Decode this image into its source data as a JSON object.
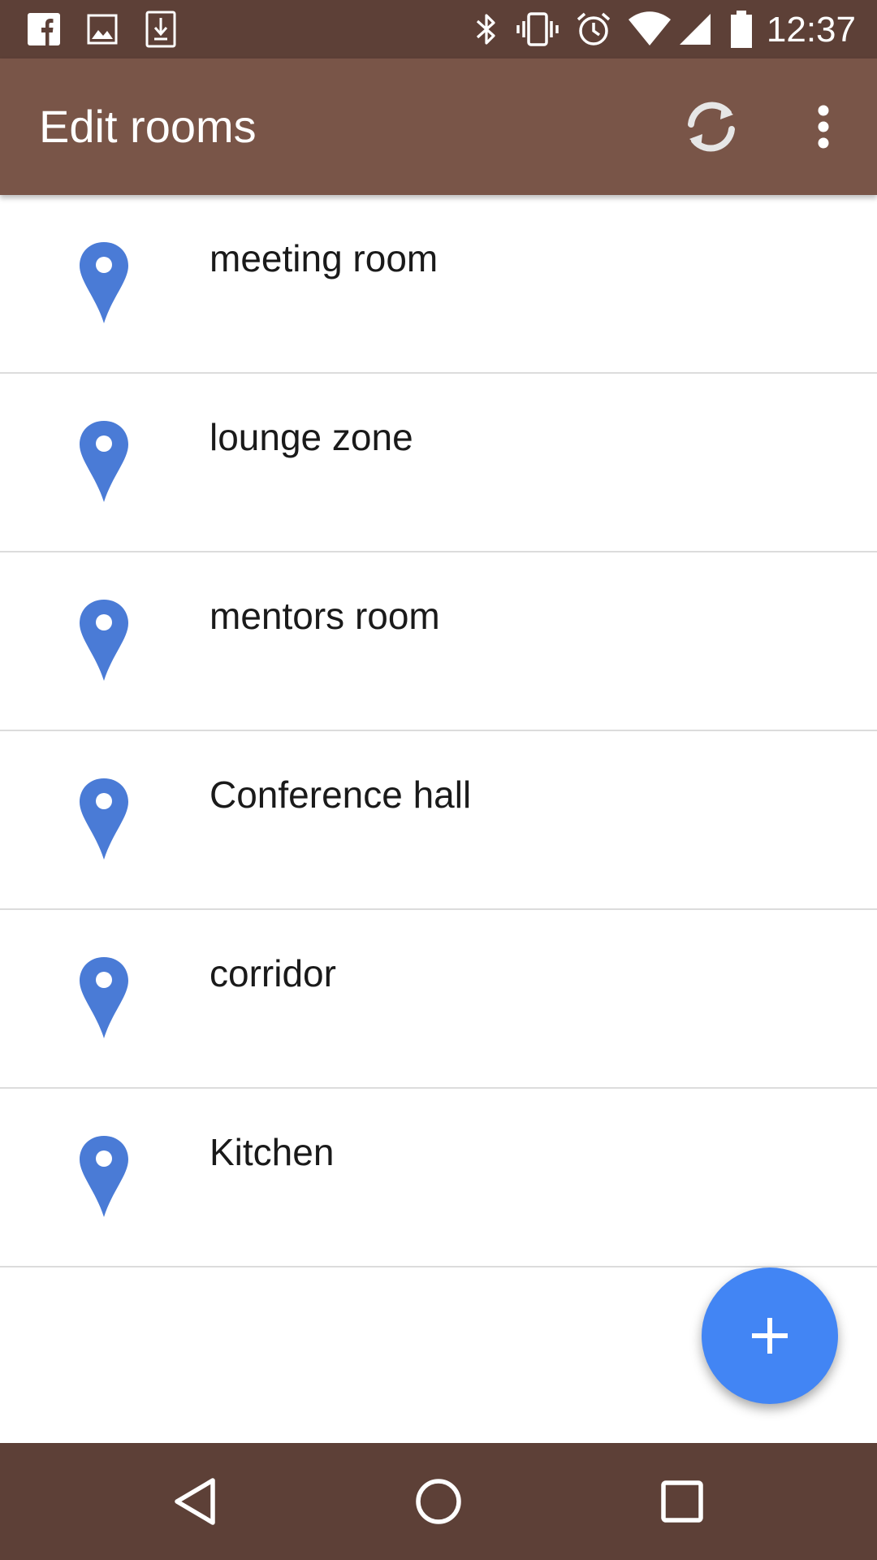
{
  "status_bar": {
    "time": "12:37",
    "left_icons": [
      "facebook-icon",
      "image-icon",
      "download-icon"
    ],
    "right_icons": [
      "bluetooth-icon",
      "vibrate-icon",
      "alarm-icon",
      "wifi-icon",
      "signal-icon",
      "battery-icon"
    ]
  },
  "app_bar": {
    "title": "Edit rooms",
    "actions": [
      "sync-icon",
      "overflow-menu-icon"
    ]
  },
  "rooms": [
    {
      "label": "meeting room",
      "icon": "location-pin-icon"
    },
    {
      "label": "lounge zone",
      "icon": "location-pin-icon"
    },
    {
      "label": "mentors room",
      "icon": "location-pin-icon"
    },
    {
      "label": "Conference hall",
      "icon": "location-pin-icon"
    },
    {
      "label": "corridor",
      "icon": "location-pin-icon"
    },
    {
      "label": "Kitchen",
      "icon": "location-pin-icon"
    }
  ],
  "fab": {
    "icon": "plus-icon"
  },
  "nav_bar": {
    "buttons": [
      "back-icon",
      "home-icon",
      "recents-icon"
    ]
  },
  "colors": {
    "status_bar": "#5d4037",
    "app_bar": "#795548",
    "pin": "#4a7bd6",
    "fab": "#4285f4",
    "divider": "#dcdcdc"
  }
}
